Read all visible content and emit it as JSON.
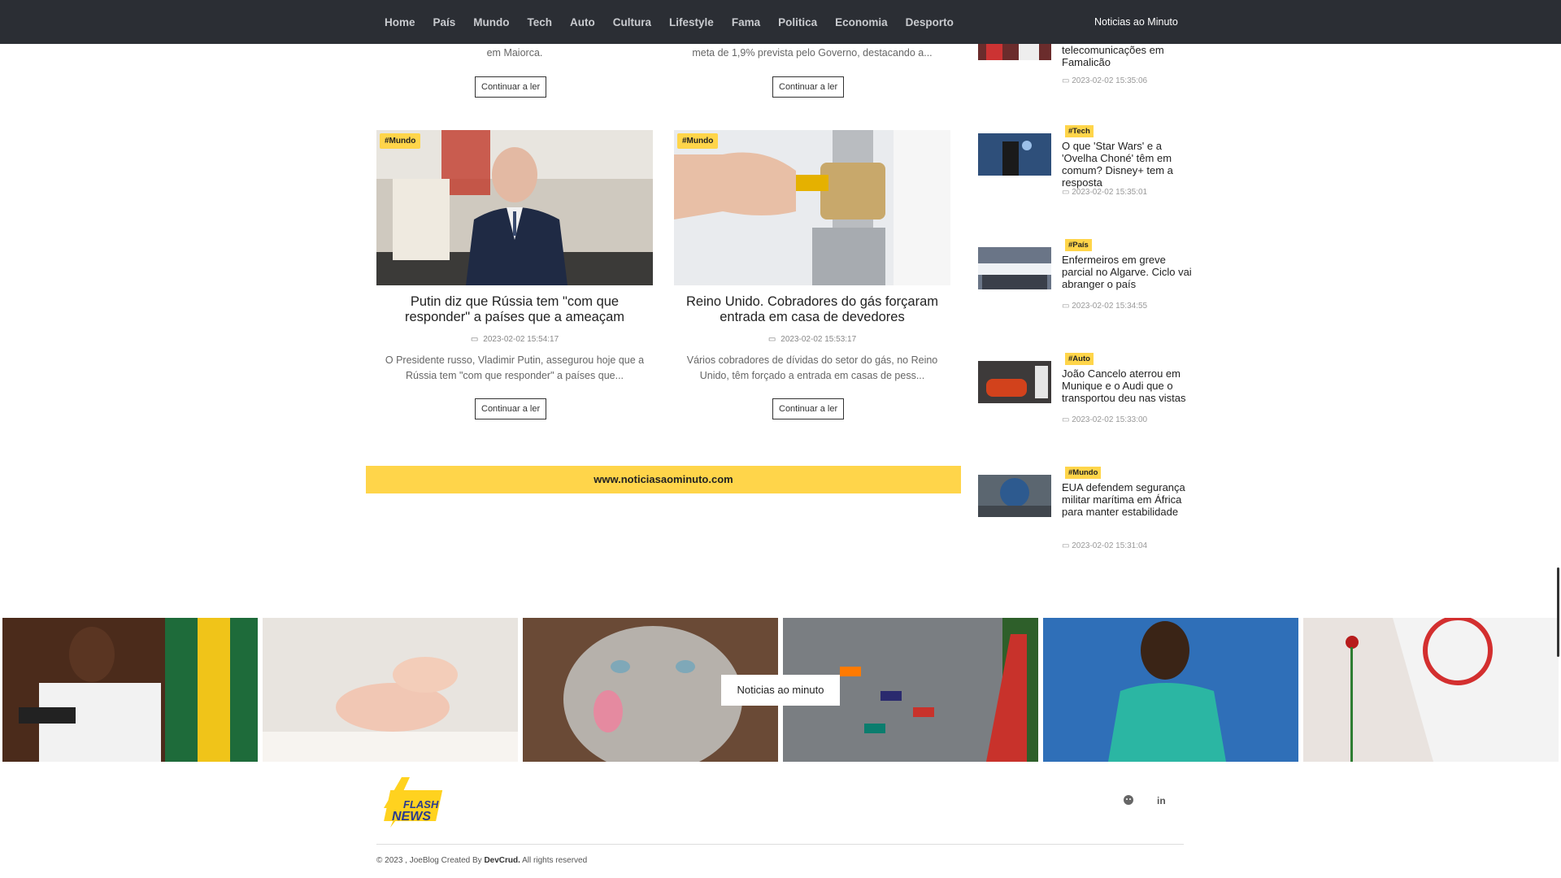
{
  "nav": {
    "items": [
      "Home",
      "País",
      "Mundo",
      "Tech",
      "Auto",
      "Cultura",
      "Lifestyle",
      "Fama",
      "Politica",
      "Economia",
      "Desporto"
    ],
    "brand": "Noticias ao Minuto"
  },
  "top_cards": [
    {
      "excerpt": "em Maiorca.",
      "button": "Continuar a ler"
    },
    {
      "excerpt": "meta de 1,9% prevista pelo Governo, destacando a...",
      "button": "Continuar a ler"
    }
  ],
  "cards": [
    {
      "tag": "#Mundo",
      "title": "Putin diz que Rússia tem \"com que responder\" a países que a ameaçam",
      "date": "2023-02-02 15:54:17",
      "excerpt": "O Presidente russo, Vladimir Putin, assegurou hoje que a Rússia tem \"com que responder\" a países que...",
      "button": "Continuar a ler"
    },
    {
      "tag": "#Mundo",
      "title": "Reino Unido. Cobradores do gás forçaram entrada em casa de devedores",
      "date": "2023-02-02 15:53:17",
      "excerpt": "Vários cobradores de dívidas do setor do gás, no Reino Unido, têm forçado a entrada em casas de pess...",
      "button": "Continuar a ler"
    }
  ],
  "banner": "www.noticiasaominuto.com",
  "sidebar": {
    "items": [
      {
        "tag": "",
        "title": "telecomunicações em Famalicão",
        "date": "2023-02-02 15:35:06"
      },
      {
        "tag": "#Tech",
        "title": "O que 'Star Wars' e a 'Ovelha Choné' têm em comum? Disney+ tem a resposta",
        "date": "2023-02-02 15:35:01"
      },
      {
        "tag": "#País",
        "title": "Enfermeiros em greve parcial no Algarve. Ciclo vai abranger o país",
        "date": "2023-02-02 15:34:55"
      },
      {
        "tag": "#Auto",
        "title": "João Cancelo aterrou em Munique e o Audi que o transportou deu nas vistas",
        "date": "2023-02-02 15:33:00"
      },
      {
        "tag": "#Mundo",
        "title": "EUA defendem segurança militar marítima em África para manter estabilidade",
        "date": "2023-02-02 15:31:04"
      }
    ]
  },
  "gallery": {
    "label": "Noticias ao minuto",
    "images": [
      "speaker-photo",
      "baby-feet-photo",
      "cat-photo",
      "f1-race-photo",
      "football-player-photo",
      "party-flag-photo"
    ]
  },
  "footer": {
    "logo_line1": "FLASH",
    "logo_line2": "NEWS",
    "copyright_prefix": "© 2023 , JoeBlog Created By ",
    "copyright_author": "DevCrud.",
    "copyright_suffix": " All rights reserved",
    "social": [
      "github-icon",
      "linkedin-icon"
    ]
  },
  "colors": {
    "nav_bg": "#2b2e34",
    "accent": "#ffd54a"
  }
}
